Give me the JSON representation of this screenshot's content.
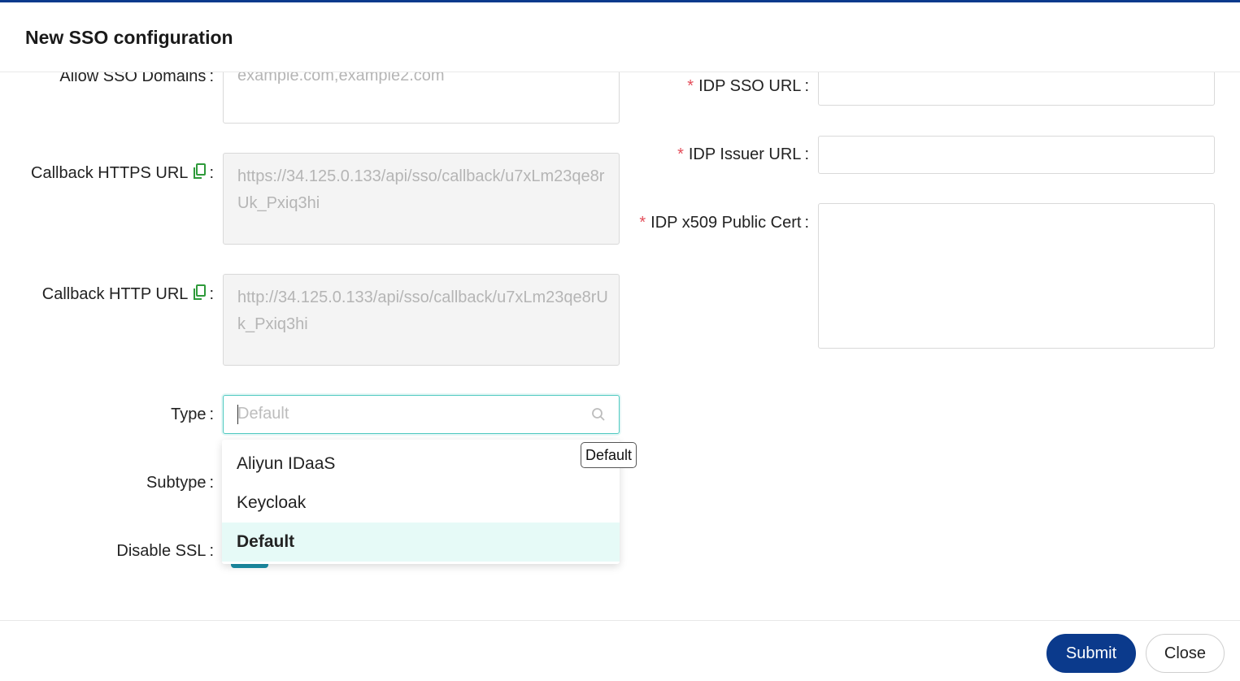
{
  "dialog": {
    "title": "New SSO configuration"
  },
  "form": {
    "allow_domains": {
      "label": "Allow SSO Domains",
      "placeholder": "example.com,example2.com"
    },
    "callback_https": {
      "label": "Callback HTTPS URL",
      "value": "https://34.125.0.133/api/sso/callback/u7xLm23qe8rUk_Pxiq3hi"
    },
    "callback_http": {
      "label": "Callback HTTP URL",
      "value": "http://34.125.0.133/api/sso/callback/u7xLm23qe8rUk_Pxiq3hi"
    },
    "type": {
      "label": "Type",
      "placeholder": "Default"
    },
    "subtype": {
      "label": "Subtype"
    },
    "disable_ssl": {
      "label": "Disable SSL"
    },
    "idp_sso_url": {
      "label": "IDP SSO URL",
      "required_mark": "*"
    },
    "idp_issuer_url": {
      "label": "IDP Issuer URL",
      "required_mark": "*"
    },
    "idp_cert": {
      "label": "IDP x509 Public Cert",
      "required_mark": "*"
    },
    "colon": ":"
  },
  "type_dropdown": {
    "options": [
      {
        "label": "Aliyun IDaaS",
        "selected": false
      },
      {
        "label": "Keycloak",
        "selected": false
      },
      {
        "label": "Default",
        "selected": true
      }
    ],
    "tooltip": "Default"
  },
  "footer": {
    "submit_label": "Submit",
    "close_label": "Close"
  },
  "colors": {
    "primary": "#0b3a8c",
    "focus": "#4fc9c0",
    "selected_bg": "#e6faf7",
    "required": "#e34d59",
    "copy_icon": "#2e9a3a"
  },
  "icons": {
    "copy": "copy-icon",
    "search": "search-icon"
  }
}
